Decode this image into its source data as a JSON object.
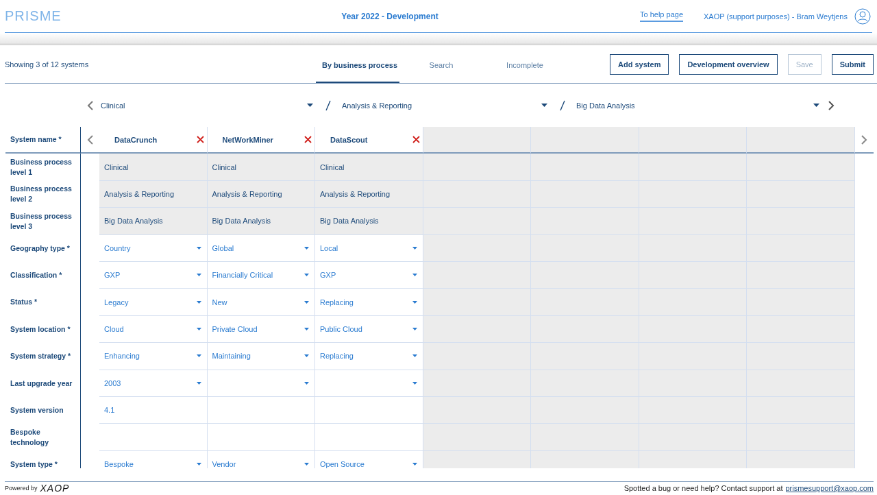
{
  "header": {
    "logo": "PRISME",
    "title": "Year 2022 - Development",
    "help_link": "To help page",
    "user": "XAOP (support purposes) - Bram Weytjens"
  },
  "toolbar": {
    "count": "Showing 3 of 12 systems",
    "tabs": [
      {
        "label": "By business process",
        "selected": true
      },
      {
        "label": "Search",
        "selected": false
      },
      {
        "label": "Incomplete",
        "selected": false
      }
    ],
    "buttons": [
      {
        "label": "Add system",
        "disabled": false
      },
      {
        "label": "Development overview",
        "disabled": false
      },
      {
        "label": "Save",
        "disabled": true
      },
      {
        "label": "Submit",
        "disabled": false
      }
    ]
  },
  "breadcrumb": [
    "Clinical",
    "Analysis & Reporting",
    "Big Data Analysis"
  ],
  "table": {
    "name_label": "System name *",
    "rows": [
      {
        "label": "Business process level 1",
        "kind": "readonly"
      },
      {
        "label": "Business process level 2",
        "kind": "readonly"
      },
      {
        "label": "Business process level 3",
        "kind": "readonly"
      },
      {
        "label": "Geography type *",
        "kind": "dropdown"
      },
      {
        "label": "Classification *",
        "kind": "dropdown"
      },
      {
        "label": "Status *",
        "kind": "dropdown"
      },
      {
        "label": "System location *",
        "kind": "dropdown"
      },
      {
        "label": "System strategy *",
        "kind": "dropdown"
      },
      {
        "label": "Last upgrade year",
        "kind": "dropdown"
      },
      {
        "label": "System version",
        "kind": "text"
      },
      {
        "label": "Bespoke technology",
        "kind": "text"
      },
      {
        "label": "System type *",
        "kind": "dropdown"
      }
    ],
    "systems": [
      {
        "name": "DataCrunch",
        "cells": [
          "Clinical",
          "Analysis & Reporting",
          "Big Data Analysis",
          "Country",
          "GXP",
          "Legacy",
          "Cloud",
          "Enhancing",
          "2003",
          "4.1",
          null,
          "Bespoke"
        ]
      },
      {
        "name": "NetWorkMiner",
        "cells": [
          "Clinical",
          "Analysis & Reporting",
          "Big Data Analysis",
          "Global",
          "Financially Critical",
          "New",
          "Private Cloud",
          "Maintaining",
          null,
          null,
          null,
          "Vendor"
        ]
      },
      {
        "name": "DataScout",
        "cells": [
          "Clinical",
          "Analysis & Reporting",
          "Big Data Analysis",
          "Local",
          "GXP",
          "Replacing",
          "Public Cloud",
          "Replacing",
          null,
          null,
          null,
          "Open Source"
        ]
      }
    ]
  },
  "footer": {
    "powered_by": "Powered by",
    "brand": "XAOP",
    "help_text": "Spotted a bug or need help? Contact support at",
    "email": "prismesupport@xaop.com"
  }
}
